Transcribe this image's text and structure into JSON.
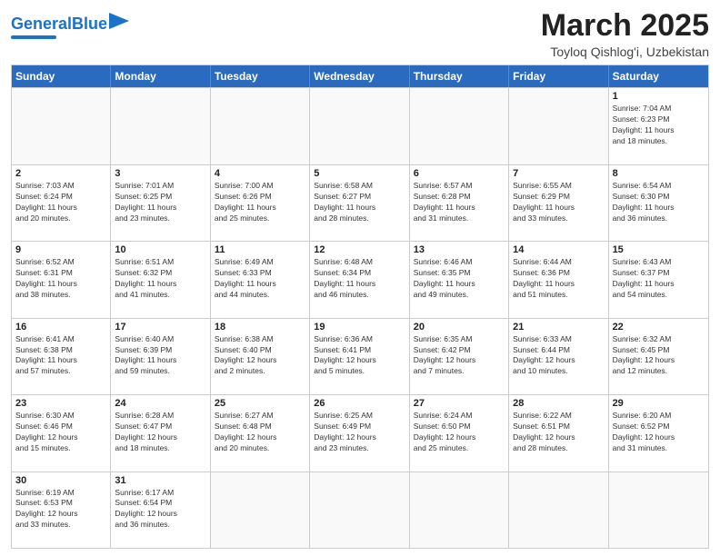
{
  "header": {
    "logo_general": "General",
    "logo_blue": "Blue",
    "month_title": "March 2025",
    "location": "Toyloq Qishlog'i, Uzbekistan"
  },
  "days_of_week": [
    "Sunday",
    "Monday",
    "Tuesday",
    "Wednesday",
    "Thursday",
    "Friday",
    "Saturday"
  ],
  "weeks": [
    [
      {
        "day": "",
        "info": ""
      },
      {
        "day": "",
        "info": ""
      },
      {
        "day": "",
        "info": ""
      },
      {
        "day": "",
        "info": ""
      },
      {
        "day": "",
        "info": ""
      },
      {
        "day": "",
        "info": ""
      },
      {
        "day": "1",
        "info": "Sunrise: 7:04 AM\nSunset: 6:23 PM\nDaylight: 11 hours\nand 18 minutes."
      }
    ],
    [
      {
        "day": "2",
        "info": "Sunrise: 7:03 AM\nSunset: 6:24 PM\nDaylight: 11 hours\nand 20 minutes."
      },
      {
        "day": "3",
        "info": "Sunrise: 7:01 AM\nSunset: 6:25 PM\nDaylight: 11 hours\nand 23 minutes."
      },
      {
        "day": "4",
        "info": "Sunrise: 7:00 AM\nSunset: 6:26 PM\nDaylight: 11 hours\nand 25 minutes."
      },
      {
        "day": "5",
        "info": "Sunrise: 6:58 AM\nSunset: 6:27 PM\nDaylight: 11 hours\nand 28 minutes."
      },
      {
        "day": "6",
        "info": "Sunrise: 6:57 AM\nSunset: 6:28 PM\nDaylight: 11 hours\nand 31 minutes."
      },
      {
        "day": "7",
        "info": "Sunrise: 6:55 AM\nSunset: 6:29 PM\nDaylight: 11 hours\nand 33 minutes."
      },
      {
        "day": "8",
        "info": "Sunrise: 6:54 AM\nSunset: 6:30 PM\nDaylight: 11 hours\nand 36 minutes."
      }
    ],
    [
      {
        "day": "9",
        "info": "Sunrise: 6:52 AM\nSunset: 6:31 PM\nDaylight: 11 hours\nand 38 minutes."
      },
      {
        "day": "10",
        "info": "Sunrise: 6:51 AM\nSunset: 6:32 PM\nDaylight: 11 hours\nand 41 minutes."
      },
      {
        "day": "11",
        "info": "Sunrise: 6:49 AM\nSunset: 6:33 PM\nDaylight: 11 hours\nand 44 minutes."
      },
      {
        "day": "12",
        "info": "Sunrise: 6:48 AM\nSunset: 6:34 PM\nDaylight: 11 hours\nand 46 minutes."
      },
      {
        "day": "13",
        "info": "Sunrise: 6:46 AM\nSunset: 6:35 PM\nDaylight: 11 hours\nand 49 minutes."
      },
      {
        "day": "14",
        "info": "Sunrise: 6:44 AM\nSunset: 6:36 PM\nDaylight: 11 hours\nand 51 minutes."
      },
      {
        "day": "15",
        "info": "Sunrise: 6:43 AM\nSunset: 6:37 PM\nDaylight: 11 hours\nand 54 minutes."
      }
    ],
    [
      {
        "day": "16",
        "info": "Sunrise: 6:41 AM\nSunset: 6:38 PM\nDaylight: 11 hours\nand 57 minutes."
      },
      {
        "day": "17",
        "info": "Sunrise: 6:40 AM\nSunset: 6:39 PM\nDaylight: 11 hours\nand 59 minutes."
      },
      {
        "day": "18",
        "info": "Sunrise: 6:38 AM\nSunset: 6:40 PM\nDaylight: 12 hours\nand 2 minutes."
      },
      {
        "day": "19",
        "info": "Sunrise: 6:36 AM\nSunset: 6:41 PM\nDaylight: 12 hours\nand 5 minutes."
      },
      {
        "day": "20",
        "info": "Sunrise: 6:35 AM\nSunset: 6:42 PM\nDaylight: 12 hours\nand 7 minutes."
      },
      {
        "day": "21",
        "info": "Sunrise: 6:33 AM\nSunset: 6:44 PM\nDaylight: 12 hours\nand 10 minutes."
      },
      {
        "day": "22",
        "info": "Sunrise: 6:32 AM\nSunset: 6:45 PM\nDaylight: 12 hours\nand 12 minutes."
      }
    ],
    [
      {
        "day": "23",
        "info": "Sunrise: 6:30 AM\nSunset: 6:46 PM\nDaylight: 12 hours\nand 15 minutes."
      },
      {
        "day": "24",
        "info": "Sunrise: 6:28 AM\nSunset: 6:47 PM\nDaylight: 12 hours\nand 18 minutes."
      },
      {
        "day": "25",
        "info": "Sunrise: 6:27 AM\nSunset: 6:48 PM\nDaylight: 12 hours\nand 20 minutes."
      },
      {
        "day": "26",
        "info": "Sunrise: 6:25 AM\nSunset: 6:49 PM\nDaylight: 12 hours\nand 23 minutes."
      },
      {
        "day": "27",
        "info": "Sunrise: 6:24 AM\nSunset: 6:50 PM\nDaylight: 12 hours\nand 25 minutes."
      },
      {
        "day": "28",
        "info": "Sunrise: 6:22 AM\nSunset: 6:51 PM\nDaylight: 12 hours\nand 28 minutes."
      },
      {
        "day": "29",
        "info": "Sunrise: 6:20 AM\nSunset: 6:52 PM\nDaylight: 12 hours\nand 31 minutes."
      }
    ],
    [
      {
        "day": "30",
        "info": "Sunrise: 6:19 AM\nSunset: 6:53 PM\nDaylight: 12 hours\nand 33 minutes."
      },
      {
        "day": "31",
        "info": "Sunrise: 6:17 AM\nSunset: 6:54 PM\nDaylight: 12 hours\nand 36 minutes."
      },
      {
        "day": "",
        "info": ""
      },
      {
        "day": "",
        "info": ""
      },
      {
        "day": "",
        "info": ""
      },
      {
        "day": "",
        "info": ""
      },
      {
        "day": "",
        "info": ""
      }
    ]
  ]
}
